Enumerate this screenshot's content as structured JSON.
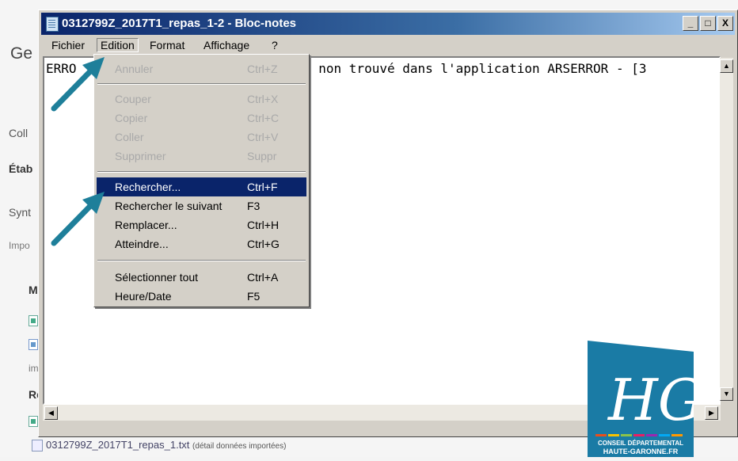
{
  "background_page": {
    "title_partial": "Ge",
    "side_labels": [
      "Coll",
      "Étab",
      "Synt",
      "Impo",
      "M",
      "im",
      "Re"
    ],
    "footer_file": "0312799Z_2017T1_repas_1.txt",
    "footer_note": "(détail données importées)"
  },
  "window": {
    "title": "0312799Z_2017T1_repas_1-2 - Bloc-notes",
    "buttons": {
      "minimize": "_",
      "maximize": "□",
      "close": "X"
    },
    "menu": [
      "Fichier",
      "Edition",
      "Format",
      "Affichage",
      "?"
    ],
    "open_menu": "Edition",
    "content_line_start": "ERRO",
    "content_line_end": "6 non trouvé dans l'application ARSERROR - [3"
  },
  "edition_menu": {
    "items": [
      {
        "label": "Annuler",
        "shortcut": "Ctrl+Z",
        "enabled": false
      },
      {
        "label": "Couper",
        "shortcut": "Ctrl+X",
        "enabled": false
      },
      {
        "label": "Copier",
        "shortcut": "Ctrl+C",
        "enabled": false
      },
      {
        "label": "Coller",
        "shortcut": "Ctrl+V",
        "enabled": false
      },
      {
        "label": "Supprimer",
        "shortcut": "Suppr",
        "enabled": false
      },
      {
        "label": "Rechercher...",
        "shortcut": "Ctrl+F",
        "enabled": true,
        "highlighted": true
      },
      {
        "label": "Rechercher le suivant",
        "shortcut": "F3",
        "enabled": true
      },
      {
        "label": "Remplacer...",
        "shortcut": "Ctrl+H",
        "enabled": true
      },
      {
        "label": "Atteindre...",
        "shortcut": "Ctrl+G",
        "enabled": true
      },
      {
        "label": "Sélectionner tout",
        "shortcut": "Ctrl+A",
        "enabled": true
      },
      {
        "label": "Heure/Date",
        "shortcut": "F5",
        "enabled": true
      }
    ]
  },
  "logo": {
    "letters": "HG",
    "line1": "CONSEIL DÉPARTEMENTAL",
    "line2": "HAUTE-GARONNE.FR",
    "color": "#1a7ba5"
  },
  "colors": {
    "arrow": "#1e7f9a",
    "highlight": "#0a246a",
    "titlebar_start": "#0a246a"
  }
}
